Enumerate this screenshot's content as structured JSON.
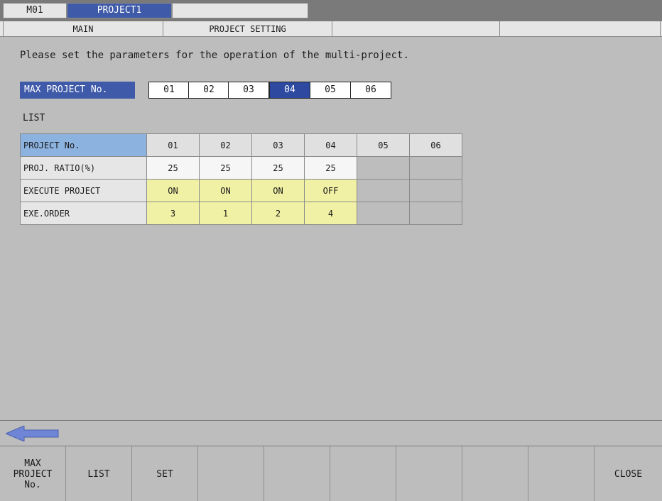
{
  "header": {
    "machine": "M01",
    "project": "PROJECT1"
  },
  "subtabs": [
    "MAIN",
    "PROJECT SETTING",
    "",
    ""
  ],
  "instruction": "Please set the parameters for the operation of the multi-project.",
  "max_project": {
    "label": "MAX PROJECT No.",
    "options": [
      "01",
      "02",
      "03",
      "04",
      "05",
      "06"
    ],
    "selected": "04"
  },
  "list_label": "LIST",
  "table": {
    "header_label": "PROJECT No.",
    "columns": [
      "01",
      "02",
      "03",
      "04",
      "05",
      "06"
    ],
    "rows": [
      {
        "label": "PROJ. RATIO(%)",
        "values": [
          "25",
          "25",
          "25",
          "25",
          "",
          ""
        ]
      },
      {
        "label": "EXECUTE PROJECT",
        "values": [
          "ON",
          "ON",
          "ON",
          "OFF",
          "",
          ""
        ]
      },
      {
        "label": "EXE.ORDER",
        "values": [
          "3",
          "1",
          "2",
          "4",
          "",
          ""
        ]
      }
    ]
  },
  "function_keys": [
    "MAX\nPROJECT\nNo.",
    "LIST",
    "SET",
    "",
    "",
    "",
    "",
    "",
    "",
    "CLOSE"
  ],
  "colors": {
    "accent": "#3f5aa8",
    "selected": "#2d4aa0",
    "highlight_cell": "#f1f1a6",
    "header_highlight": "#8cb2e0",
    "arrow": "#6f86d6"
  },
  "icons": {
    "back": "left-arrow-icon"
  }
}
